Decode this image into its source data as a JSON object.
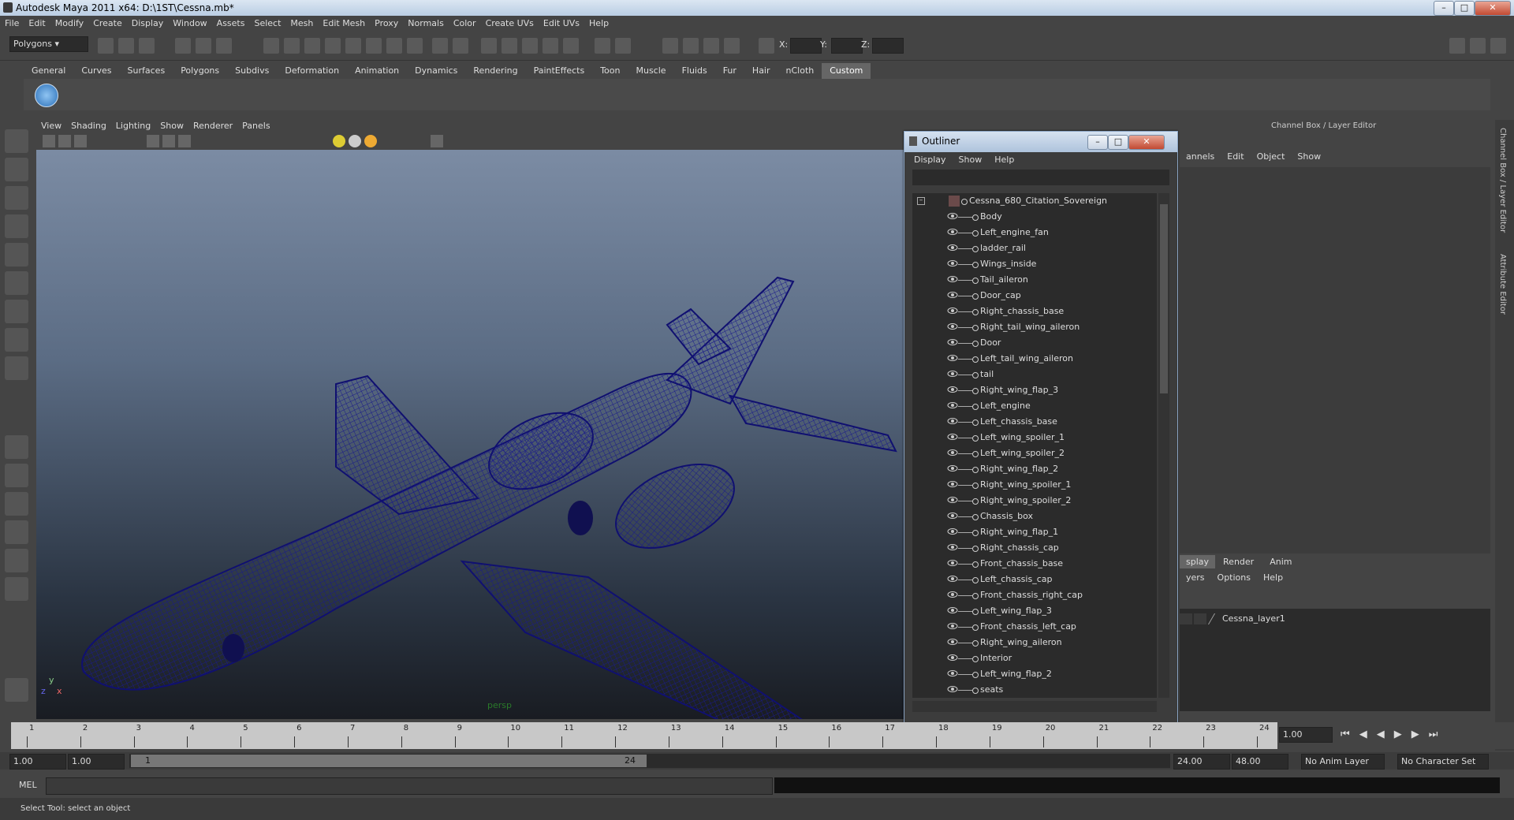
{
  "window": {
    "title": "Autodesk Maya 2011 x64: D:\\1ST\\Cessna.mb*"
  },
  "menubar": [
    "File",
    "Edit",
    "Modify",
    "Create",
    "Display",
    "Window",
    "Assets",
    "Select",
    "Mesh",
    "Edit Mesh",
    "Proxy",
    "Normals",
    "Color",
    "Create UVs",
    "Edit UVs",
    "Help"
  ],
  "toolbar": {
    "mode": "Polygons",
    "x_label": "X:",
    "y_label": "Y:",
    "z_label": "Z:"
  },
  "shelf_tabs": [
    "General",
    "Curves",
    "Surfaces",
    "Polygons",
    "Subdivs",
    "Deformation",
    "Animation",
    "Dynamics",
    "Rendering",
    "PaintEffects",
    "Toon",
    "Muscle",
    "Fluids",
    "Fur",
    "Hair",
    "nCloth",
    "Custom"
  ],
  "viewport": {
    "menu": [
      "View",
      "Shading",
      "Lighting",
      "Show",
      "Renderer",
      "Panels"
    ],
    "camera": "persp",
    "axis_y": "y",
    "axis_x": "x",
    "axis_z": "z"
  },
  "outliner": {
    "title": "Outliner",
    "menu": [
      "Display",
      "Show",
      "Help"
    ],
    "root": "Cessna_680_Citation_Sovereign",
    "items": [
      "Body",
      "Left_engine_fan",
      "ladder_rail",
      "Wings_inside",
      "Tail_aileron",
      "Door_cap",
      "Right_chassis_base",
      "Right_tail_wing_aileron",
      "Door",
      "Left_tail_wing_aileron",
      "tail",
      "Right_wing_flap_3",
      "Left_engine",
      "Left_chassis_base",
      "Left_wing_spoiler_1",
      "Left_wing_spoiler_2",
      "Right_wing_flap_2",
      "Right_wing_spoiler_1",
      "Right_wing_spoiler_2",
      "Chassis_box",
      "Right_wing_flap_1",
      "Right_chassis_cap",
      "Front_chassis_base",
      "Left_chassis_cap",
      "Front_chassis_right_cap",
      "Left_wing_flap_3",
      "Front_chassis_left_cap",
      "Right_wing_aileron",
      "Interior",
      "Left_wing_flap_2",
      "seats"
    ]
  },
  "channelbox": {
    "title": "Channel Box / Layer Editor",
    "menu": [
      "annels",
      "Edit",
      "Object",
      "Show"
    ],
    "layer_tabs": [
      "splay",
      "Render",
      "Anim"
    ],
    "layer_menu": [
      "yers",
      "Options",
      "Help"
    ],
    "layer_name": "Cessna_layer1"
  },
  "side_tabs": [
    "Channel Box / Layer Editor",
    "Attribute Editor"
  ],
  "timeline": {
    "ticks": [
      "1",
      "2",
      "3",
      "4",
      "5",
      "6",
      "7",
      "8",
      "9",
      "10",
      "11",
      "12",
      "13",
      "14",
      "15",
      "16",
      "17",
      "18",
      "19",
      "20",
      "21",
      "22",
      "23",
      "24"
    ],
    "current_frame": "1.00"
  },
  "range": {
    "start": "1.00",
    "start2": "1.00",
    "slider_start": "1",
    "slider_end": "24",
    "end": "24.00",
    "end2": "48.00",
    "anim_layer": "No Anim Layer",
    "char_set": "No Character Set"
  },
  "cmdline": {
    "label": "MEL"
  },
  "status": {
    "text": "Select Tool: select an object"
  }
}
